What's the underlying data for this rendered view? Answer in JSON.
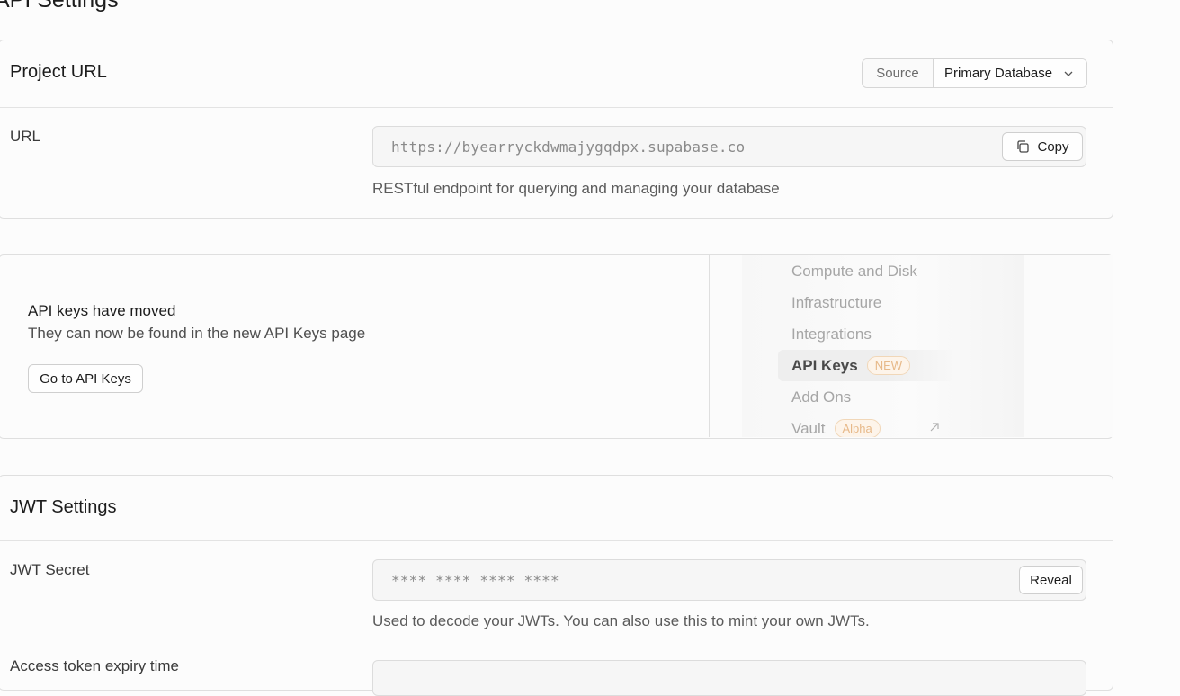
{
  "page": {
    "title": "API Settings"
  },
  "project_url": {
    "title": "Project URL",
    "source_label": "Source",
    "source_value": "Primary Database",
    "url_label": "URL",
    "url_value": "https://byearryckdwmajygqdpx.supabase.co",
    "copy_label": "Copy",
    "help": "RESTful endpoint for querying and managing your database"
  },
  "api_keys_moved": {
    "title": "API keys have moved",
    "subtitle": "They can now be found in the new API Keys page",
    "button_label": "Go to API Keys",
    "menu": [
      {
        "label": "Compute and Disk"
      },
      {
        "label": "Infrastructure"
      },
      {
        "label": "Integrations"
      },
      {
        "label": "API Keys",
        "badge": "NEW"
      },
      {
        "label": "Add Ons"
      },
      {
        "label": "Vault",
        "badge": "Alpha"
      }
    ]
  },
  "jwt": {
    "title": "JWT Settings",
    "secret_label": "JWT Secret",
    "secret_value": "**** **** **** ****",
    "reveal_label": "Reveal",
    "help": "Used to decode your JWTs. You can also use this to mint your own JWTs.",
    "expiry_label": "Access token expiry time"
  }
}
